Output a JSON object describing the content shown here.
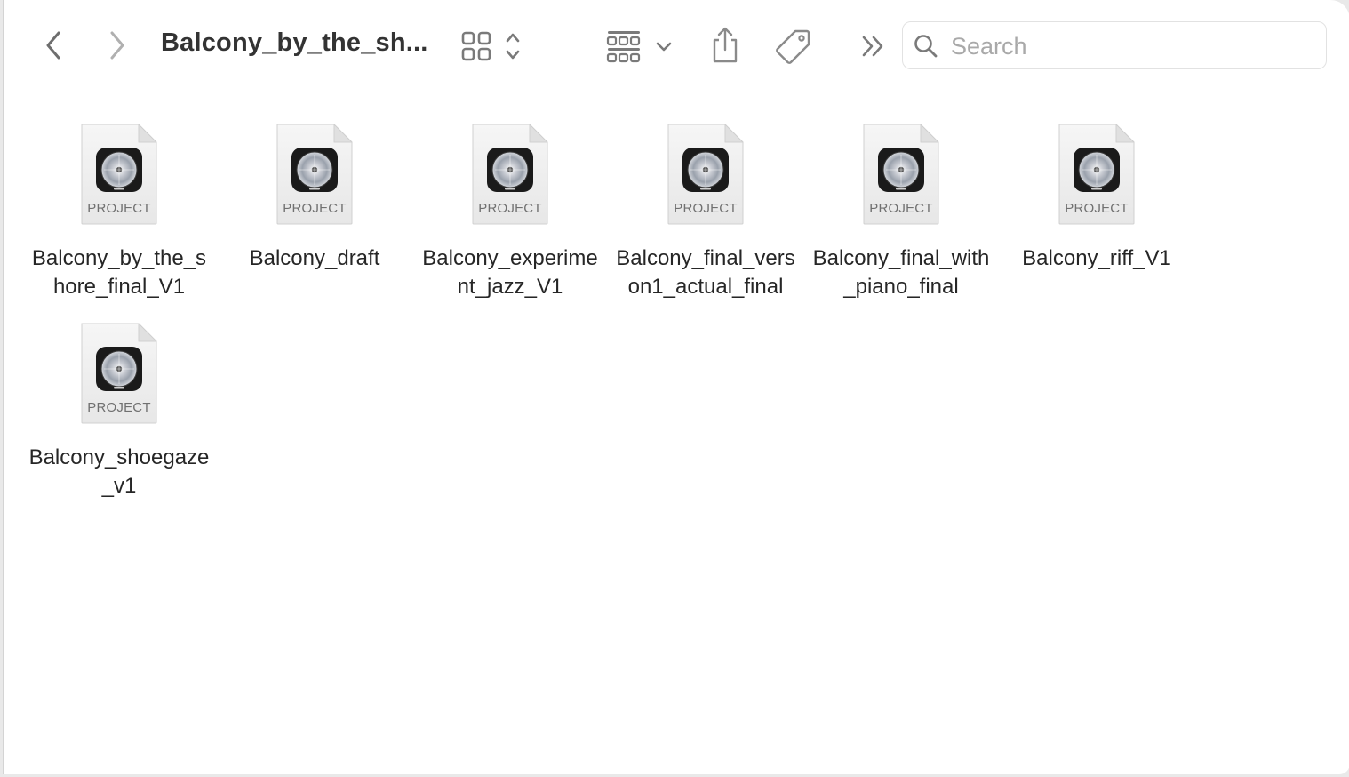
{
  "window": {
    "title": "Balcony_by_the_sh..."
  },
  "toolbar": {
    "back_label": "Back",
    "forward_label": "Forward",
    "search_placeholder": "Search"
  },
  "files": [
    {
      "name": "Balcony_by_the_shore_final_V1",
      "kind": "PROJECT"
    },
    {
      "name": "Balcony_draft",
      "kind": "PROJECT"
    },
    {
      "name": "Balcony_experiment_jazz_V1",
      "kind": "PROJECT"
    },
    {
      "name": "Balcony_final_verson1_actual_final",
      "kind": "PROJECT"
    },
    {
      "name": "Balcony_final_with_piano_final",
      "kind": "PROJECT"
    },
    {
      "name": "Balcony_riff_V1",
      "kind": "PROJECT"
    },
    {
      "name": "Balcony_shoegaze_v1",
      "kind": "PROJECT"
    }
  ],
  "colors": {
    "icon_gray": "#8a8a8a",
    "text": "#262626",
    "placeholder": "#a9a9a9"
  }
}
